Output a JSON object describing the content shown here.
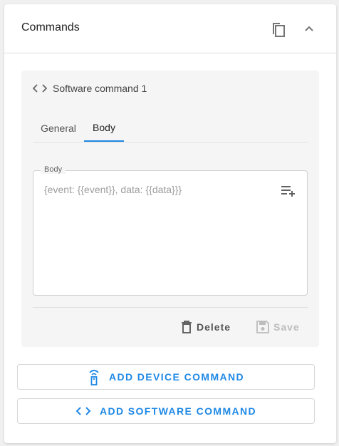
{
  "header": {
    "title": "Commands"
  },
  "command": {
    "title": "Software command 1",
    "tabs": [
      {
        "label": "General",
        "active": false
      },
      {
        "label": "Body",
        "active": true
      }
    ],
    "body_field": {
      "label": "Body",
      "value": "{event: {{event}}, data: {{data}}}"
    },
    "actions": {
      "delete_label": "Delete",
      "save_label": "Save"
    }
  },
  "buttons": {
    "add_device": "ADD DEVICE COMMAND",
    "add_software": "ADD SOFTWARE COMMAND"
  },
  "colors": {
    "accent": "#1e88e5",
    "panel_bg": "#f5f5f5",
    "disabled": "#bdbdbd"
  }
}
